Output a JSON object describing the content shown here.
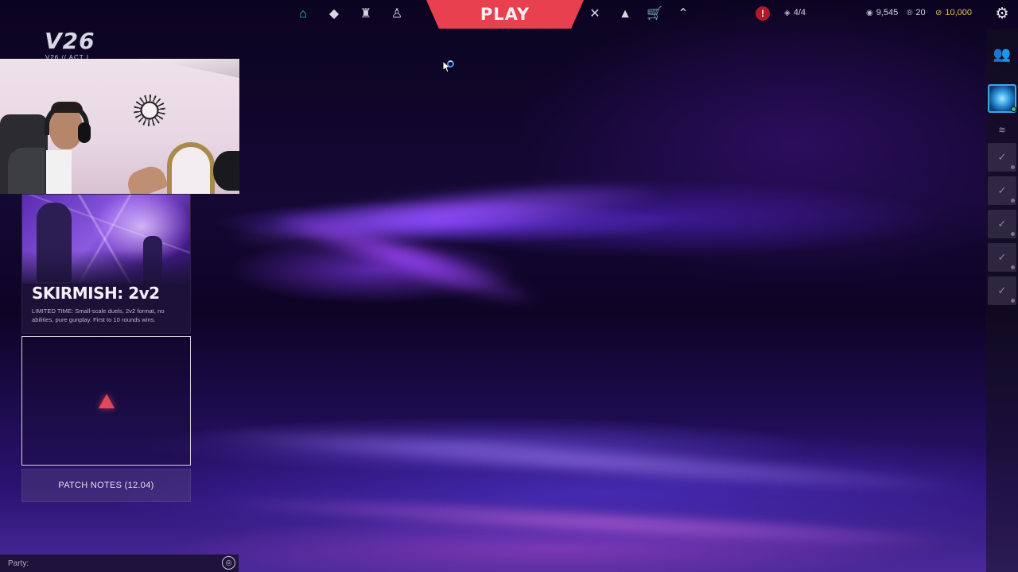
{
  "nav": {
    "left_icons": [
      {
        "name": "home-icon",
        "glyph": "⌂",
        "active": true
      },
      {
        "name": "agents-icon",
        "glyph": "◆"
      },
      {
        "name": "career-icon",
        "glyph": "♜"
      },
      {
        "name": "battlepass-icon",
        "glyph": "♙"
      }
    ],
    "play_label": "PLAY",
    "right_icons": [
      {
        "name": "collection-icon",
        "glyph": "✕"
      },
      {
        "name": "locker-icon",
        "glyph": "▲"
      },
      {
        "name": "store-icon",
        "glyph": "🛒"
      },
      {
        "name": "rank-icon",
        "glyph": "⌃"
      }
    ],
    "play_color": "#e8404f",
    "active_color": "#35d6a6"
  },
  "header_stats": {
    "alert_glyph": "!",
    "missions": "4/4",
    "valorant_points": "9,545",
    "radianite": "20",
    "kingdom_credits": "10,000"
  },
  "logo": {
    "text": "V26",
    "subtitle": "V26 // ACT I"
  },
  "event_card": {
    "title": "SKIRMISH: 2v2",
    "description": "LIMITED TIME: Small-scale duels, 2v2 format, no abilities, pure gunplay. First to 10 rounds wins."
  },
  "patch_notes": {
    "label": "PATCH NOTES (12.04)"
  },
  "party_chat": {
    "label": "Party:"
  },
  "social": {
    "party_slots": 5
  }
}
